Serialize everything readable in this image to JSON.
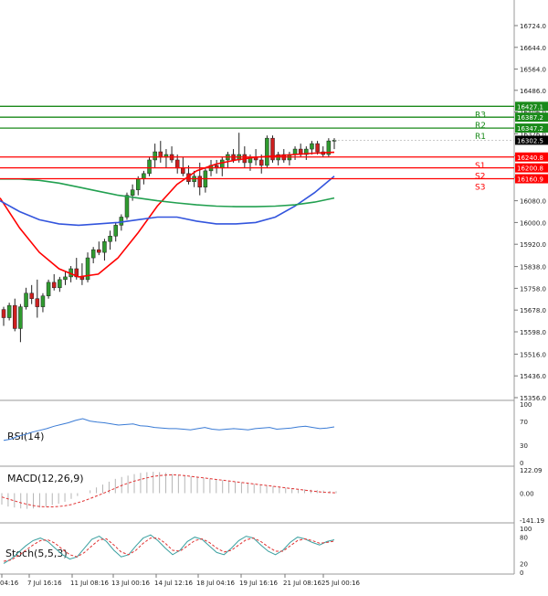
{
  "chart_data": [
    {
      "type": "candlestick",
      "price_axis_ticks": [
        "16724.0",
        "16644.0",
        "16564.0",
        "16486.0",
        "16406.0",
        "16326.0",
        "16246.0",
        "16166.0",
        "16080.0",
        "16000.0",
        "15920.0",
        "15838.0",
        "15758.0",
        "15678.0",
        "15598.0",
        "15516.0",
        "15436.0",
        "15356.0"
      ],
      "ylim": [
        15356,
        16724
      ],
      "x_tick_labels": [
        "04:16",
        "7 Jul 16:16",
        "11 Jul 08:16",
        "13 Jul 00:16",
        "14 Jul 12:16",
        "18 Jul 04:16",
        "19 Jul 16:16",
        "21 Jul 08:16",
        "25 Jul 00:16"
      ],
      "current_price": "16302.5",
      "candles": [
        [
          15680,
          15690,
          15620,
          15650
        ],
        [
          15650,
          15705,
          15640,
          15695
        ],
        [
          15695,
          15720,
          15600,
          15610
        ],
        [
          15610,
          15700,
          15560,
          15690
        ],
        [
          15690,
          15760,
          15680,
          15740
        ],
        [
          15740,
          15770,
          15700,
          15720
        ],
        [
          15720,
          15790,
          15650,
          15690
        ],
        [
          15690,
          15740,
          15670,
          15730
        ],
        [
          15730,
          15790,
          15720,
          15780
        ],
        [
          15780,
          15810,
          15750,
          15760
        ],
        [
          15760,
          15800,
          15745,
          15790
        ],
        [
          15790,
          15820,
          15770,
          15800
        ],
        [
          15800,
          15840,
          15780,
          15830
        ],
        [
          15830,
          15870,
          15790,
          15800
        ],
        [
          15800,
          15850,
          15770,
          15790
        ],
        [
          15790,
          15890,
          15780,
          15870
        ],
        [
          15870,
          15910,
          15850,
          15900
        ],
        [
          15900,
          15930,
          15880,
          15890
        ],
        [
          15890,
          15940,
          15860,
          15930
        ],
        [
          15930,
          15970,
          15900,
          15950
        ],
        [
          15950,
          16000,
          15930,
          15990
        ],
        [
          15990,
          16030,
          15970,
          16020
        ],
        [
          16020,
          16110,
          16010,
          16100
        ],
        [
          16100,
          16140,
          16080,
          16120
        ],
        [
          16120,
          16170,
          16100,
          16160
        ],
        [
          16160,
          16190,
          16140,
          16180
        ],
        [
          16180,
          16240,
          16170,
          16230
        ],
        [
          16230,
          16290,
          16200,
          16260
        ],
        [
          16260,
          16300,
          16220,
          16240
        ],
        [
          16240,
          16270,
          16200,
          16250
        ],
        [
          16250,
          16280,
          16220,
          16230
        ],
        [
          16230,
          16250,
          16180,
          16200
        ],
        [
          16200,
          16240,
          16170,
          16180
        ],
        [
          16180,
          16210,
          16140,
          16150
        ],
        [
          16150,
          16190,
          16130,
          16170
        ],
        [
          16170,
          16220,
          16100,
          16130
        ],
        [
          16130,
          16200,
          16110,
          16190
        ],
        [
          16190,
          16230,
          16170,
          16210
        ],
        [
          16210,
          16230,
          16180,
          16200
        ],
        [
          16200,
          16240,
          16170,
          16230
        ],
        [
          16230,
          16260,
          16200,
          16250
        ],
        [
          16250,
          16270,
          16220,
          16230
        ],
        [
          16230,
          16330,
          16220,
          16250
        ],
        [
          16250,
          16280,
          16200,
          16220
        ],
        [
          16220,
          16250,
          16190,
          16240
        ],
        [
          16240,
          16270,
          16210,
          16230
        ],
        [
          16230,
          16250,
          16180,
          16210
        ],
        [
          16210,
          16320,
          16200,
          16310
        ],
        [
          16310,
          16320,
          16220,
          16230
        ],
        [
          16230,
          16260,
          16210,
          16250
        ],
        [
          16250,
          16270,
          16220,
          16230
        ],
        [
          16230,
          16260,
          16210,
          16250
        ],
        [
          16250,
          16280,
          16230,
          16270
        ],
        [
          16270,
          16290,
          16240,
          16250
        ],
        [
          16250,
          16280,
          16230,
          16270
        ],
        [
          16270,
          16300,
          16250,
          16290
        ],
        [
          16290,
          16300,
          16250,
          16260
        ],
        [
          16260,
          16280,
          16240,
          16250
        ],
        [
          16250,
          16310,
          16240,
          16300
        ],
        [
          16300,
          16310,
          16270,
          16302.5
        ]
      ],
      "series": [
        {
          "color": "#ff0000",
          "values": [
            16090,
            15980,
            15890,
            15830,
            15800,
            15810,
            15870,
            15960,
            16060,
            16140,
            16190,
            16215,
            16230,
            16240,
            16245,
            16250,
            16255,
            16258
          ]
        },
        {
          "color": "#3355dd",
          "values": [
            16080,
            16040,
            16010,
            15995,
            15990,
            15995,
            16000,
            16010,
            16020,
            16020,
            16005,
            15995,
            15995,
            16000,
            16020,
            16060,
            16110,
            16170
          ]
        },
        {
          "color": "#22a050",
          "values": [
            16160,
            16160,
            16155,
            16145,
            16130,
            16115,
            16100,
            16090,
            16080,
            16072,
            16065,
            16060,
            16058,
            16058,
            16060,
            16065,
            16075,
            16090
          ]
        }
      ],
      "levels": [
        {
          "label": "R3",
          "value_label": "16427.1",
          "value": 16427.1,
          "color": "#1a8a1a"
        },
        {
          "label": "R2",
          "value_label": "16387.2",
          "value": 16387.2,
          "color": "#1a8a1a"
        },
        {
          "label": "R1",
          "value_label": "16347.2",
          "value": 16347.2,
          "color": "#1a8a1a"
        },
        {
          "label": "S1",
          "value_label": "16240.8",
          "value": 16240.8,
          "color": "#ff0000"
        },
        {
          "label": "S2",
          "value_label": "16200.8",
          "value": 16200.8,
          "color": "#ff0000"
        },
        {
          "label": "S3",
          "value_label": "16160.9",
          "value": 16160.9,
          "color": "#ff0000"
        }
      ]
    },
    {
      "type": "line",
      "title": "RSI(14)",
      "ticks": [
        "100",
        "70",
        "30",
        "0"
      ],
      "ylim": [
        0,
        100
      ],
      "series": [
        {
          "color": "#3a7bd5",
          "values": [
            38,
            40,
            45,
            48,
            52,
            55,
            58,
            62,
            65,
            68,
            72,
            75,
            71,
            69,
            68,
            66,
            64,
            65,
            66,
            63,
            62,
            60,
            59,
            58,
            58,
            57,
            56,
            58,
            60,
            57,
            56,
            57,
            58,
            57,
            56,
            58,
            59,
            60,
            57,
            58,
            59,
            61,
            62,
            60,
            58,
            59,
            61
          ]
        }
      ]
    },
    {
      "type": "bar",
      "title": "MACD(12,26,9)",
      "ticks": [
        "122.09",
        "0.00",
        "-141.19"
      ],
      "ylim": [
        -141.19,
        122.09
      ],
      "values": [
        -60,
        -70,
        -75,
        -80,
        -82,
        -80,
        -75,
        -70,
        -62,
        -55,
        -45,
        -30,
        -15,
        0,
        15,
        30,
        45,
        60,
        75,
        85,
        92,
        100,
        106,
        110,
        112,
        110,
        106,
        100,
        96,
        92,
        88,
        84,
        80,
        76,
        72,
        68,
        64,
        60,
        56,
        52,
        48,
        44,
        40,
        36,
        32,
        28,
        25,
        22,
        20,
        18,
        16,
        14,
        12,
        10
      ],
      "signal": [
        -20,
        -30,
        -40,
        -50,
        -58,
        -65,
        -70,
        -72,
        -72,
        -70,
        -66,
        -60,
        -50,
        -40,
        -28,
        -15,
        -2,
        12,
        26,
        40,
        52,
        63,
        72,
        80,
        88,
        92,
        95,
        96,
        95,
        92,
        88,
        84,
        80,
        76,
        72,
        68,
        64,
        60,
        56,
        52,
        48,
        44,
        40,
        36,
        32,
        28,
        24,
        20,
        16,
        12,
        8,
        5,
        3,
        2
      ]
    },
    {
      "type": "line",
      "title": "Stoch(5,5,3)",
      "ticks": [
        "100",
        "80",
        "20",
        "0"
      ],
      "ylim": [
        0,
        100
      ],
      "series": [
        {
          "color": "#3aa0a0",
          "values": [
            20,
            30,
            45,
            60,
            72,
            78,
            70,
            55,
            40,
            30,
            35,
            55,
            75,
            82,
            70,
            50,
            35,
            40,
            60,
            78,
            85,
            72,
            55,
            40,
            50,
            70,
            80,
            75,
            60,
            45,
            40,
            55,
            72,
            82,
            78,
            62,
            48,
            40,
            50,
            68,
            80,
            76,
            68,
            62,
            70,
            74
          ]
        },
        {
          "color": "#e03030",
          "values": [
            25,
            28,
            38,
            50,
            62,
            72,
            74,
            66,
            52,
            40,
            35,
            45,
            60,
            74,
            76,
            62,
            46,
            40,
            50,
            66,
            78,
            78,
            66,
            50,
            48,
            60,
            72,
            76,
            68,
            55,
            46,
            50,
            62,
            74,
            78,
            70,
            58,
            48,
            48,
            60,
            72,
            76,
            72,
            66,
            68,
            71
          ]
        }
      ]
    }
  ]
}
